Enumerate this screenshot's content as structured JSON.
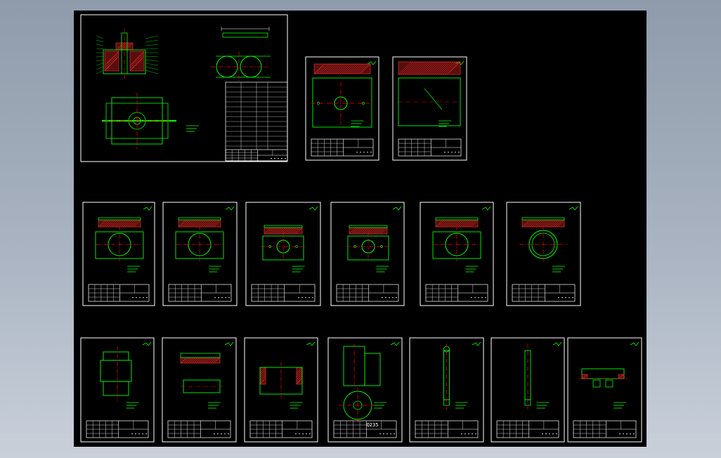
{
  "colors": {
    "background": "#000000",
    "frame": "#ffffff",
    "outline": "#00ff00",
    "center_line": "#ff0000",
    "hatch": "#ff3030",
    "dimension": "#ffffff",
    "accent": "#00ffff"
  },
  "sheets": [
    {
      "id": "assembly",
      "kind": "assembly"
    },
    {
      "id": "part-01",
      "kind": "plate"
    },
    {
      "id": "part-02",
      "kind": "plate-long"
    },
    {
      "id": "part-03",
      "kind": "ring-top"
    },
    {
      "id": "part-04",
      "kind": "ring-plain"
    },
    {
      "id": "part-05",
      "kind": "plate-holes"
    },
    {
      "id": "part-06",
      "kind": "plate-holes"
    },
    {
      "id": "part-07",
      "kind": "ring-top"
    },
    {
      "id": "part-08",
      "kind": "ring-thick"
    },
    {
      "id": "part-09",
      "kind": "sleeve"
    },
    {
      "id": "part-10",
      "kind": "bushing"
    },
    {
      "id": "part-11",
      "kind": "block"
    },
    {
      "id": "part-12",
      "kind": "round-block",
      "label": "Q235"
    },
    {
      "id": "part-13",
      "kind": "pin"
    },
    {
      "id": "part-14",
      "kind": "pin-plain"
    },
    {
      "id": "part-15",
      "kind": "stepped"
    }
  ]
}
